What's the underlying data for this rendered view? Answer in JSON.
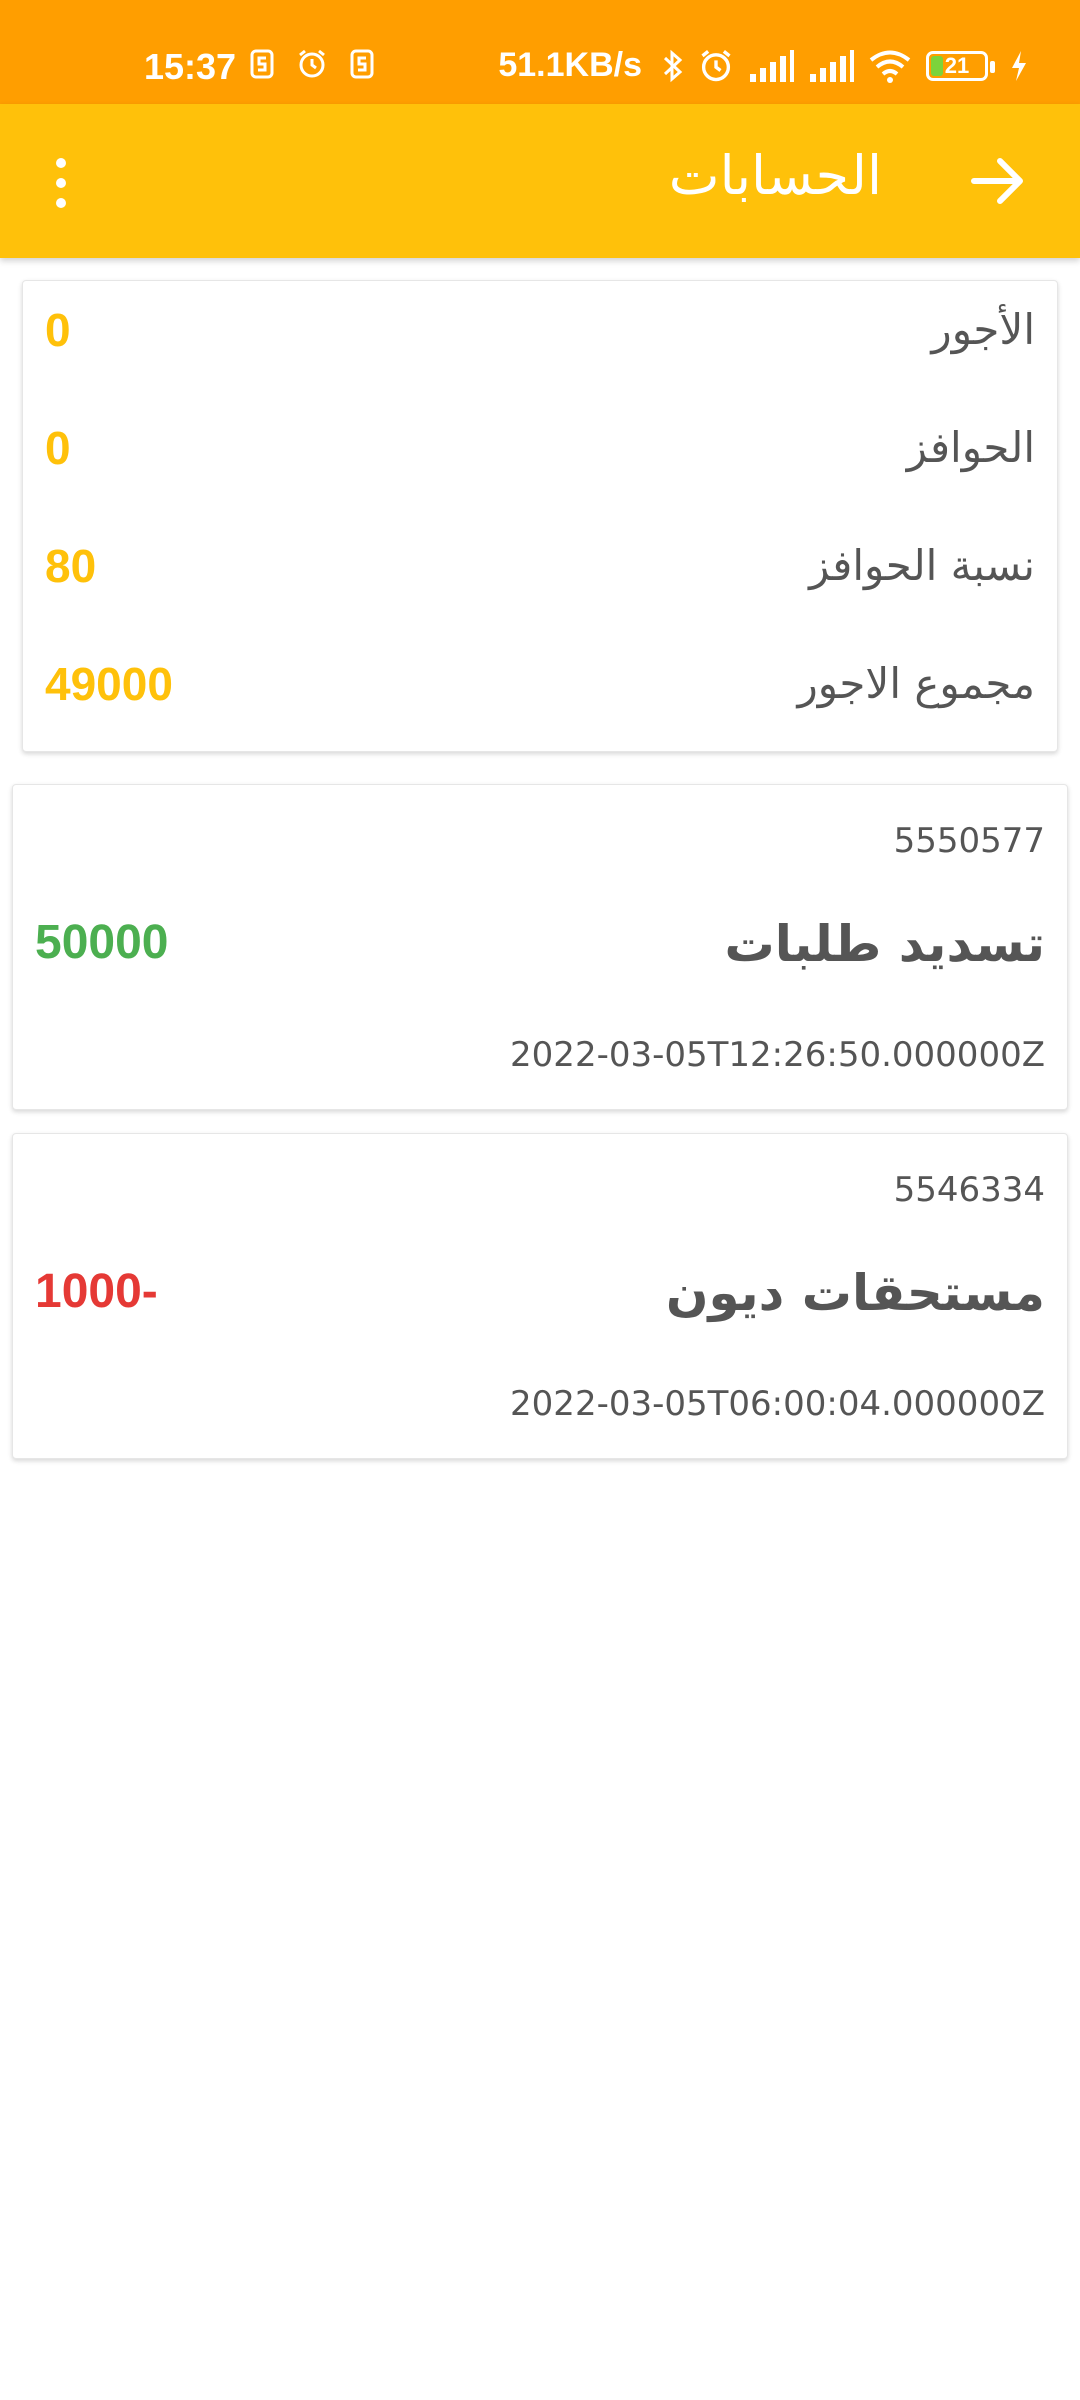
{
  "status_bar": {
    "time": "15:37",
    "speed": "51.1KB/s",
    "battery_level": "21",
    "battery_fraction": 0.21,
    "icons": [
      "sim-s-icon",
      "alarm-icon",
      "sim-s-icon",
      "bluetooth-icon",
      "alarm-icon",
      "signal-icon",
      "signal-icon",
      "wifi-icon",
      "battery-icon",
      "charging-icon"
    ]
  },
  "app_bar": {
    "title": "الحسابات",
    "back_icon": "arrow-right-icon",
    "menu_icon": "more-vertical-icon"
  },
  "summary": {
    "rows": [
      {
        "label": "الأجور",
        "value": "0"
      },
      {
        "label": "الحوافز",
        "value": "0"
      },
      {
        "label": "نسبة الحوافز",
        "value": "80"
      },
      {
        "label": "مجموع الاجور",
        "value": "49000"
      }
    ]
  },
  "transactions": [
    {
      "id": "5550577",
      "title": "تسديد طلبات",
      "amount": "50000",
      "amount_color": "#4CAF50",
      "date": "2022-03-05T12:26:50.000000Z"
    },
    {
      "id": "5546334",
      "title": "مستحقات ديون",
      "amount": "1000-",
      "amount_color": "#E53935",
      "date": "2022-03-05T06:00:04.000000Z"
    }
  ],
  "colors": {
    "status_bar": "#FF9E00",
    "app_bar": "#FFC10A",
    "accent_value": "#FFC10A",
    "positive": "#4CAF50",
    "negative": "#E53935"
  }
}
